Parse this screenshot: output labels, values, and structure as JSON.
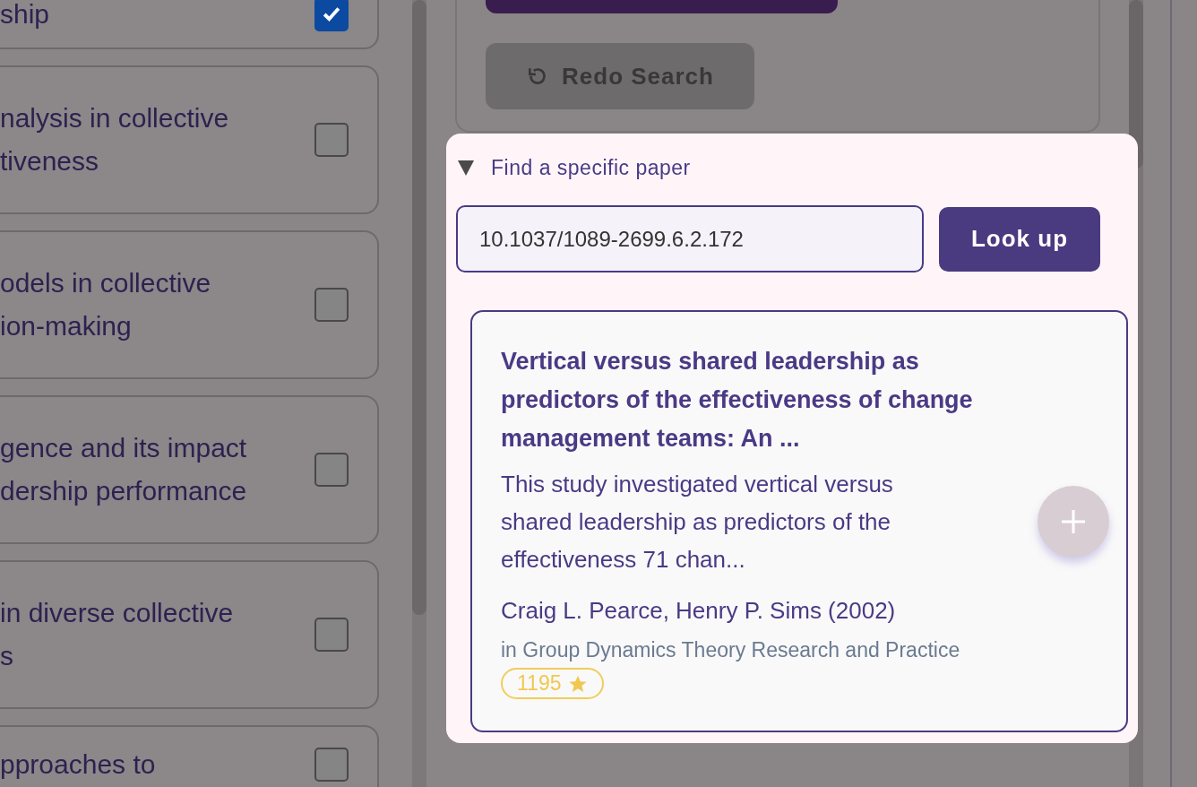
{
  "topic_cards": [
    {
      "lines": [
        "ship"
      ],
      "checked": true
    },
    {
      "lines": [
        "nalysis in collective",
        "tiveness"
      ],
      "checked": false
    },
    {
      "lines": [
        "odels in collective",
        "ion-making"
      ],
      "checked": false
    },
    {
      "lines": [
        "gence and its impact",
        "dership performance"
      ],
      "checked": false
    },
    {
      "lines": [
        "in diverse collective",
        "s"
      ],
      "checked": false
    },
    {
      "lines": [
        "pproaches to"
      ],
      "checked": false
    }
  ],
  "search_panel": {
    "redo_button": {
      "label": "Redo Search",
      "disabled": true
    }
  },
  "finder": {
    "title": "Find a specific paper",
    "expanded": true,
    "doi_field": {
      "value": "10.1037/1089-2699.6.2.172"
    },
    "lookup_button": "Look up",
    "result": {
      "title": "Vertical versus shared leadership as predictors of the effectiveness of change management teams: An ...",
      "abstract": "This study investigated vertical versus shared leadership as predictors of the effectiveness 71 chan...",
      "authors": "Craig L. Pearce, Henry P. Sims (2002)",
      "venue": "in Group Dynamics Theory Research and Practice",
      "citations": "1195"
    }
  }
}
